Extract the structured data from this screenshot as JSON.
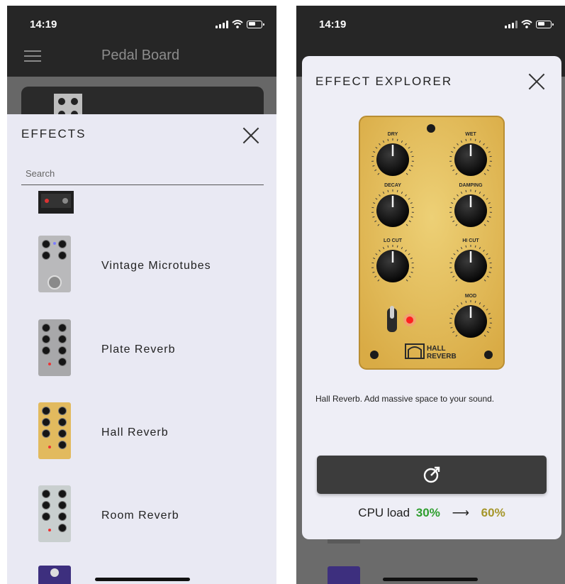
{
  "status_bar": {
    "time": "14:19"
  },
  "left": {
    "app_title": "Pedal Board",
    "sheet_title": "EFFECTS",
    "search_placeholder": "Search",
    "effects": [
      {
        "label": "Vintage Microtubes",
        "icon": "vintage-microtubes-pedal-icon",
        "color": "#b9b9bb"
      },
      {
        "label": "Plate Reverb",
        "icon": "plate-reverb-pedal-icon",
        "color": "#a8a8aa"
      },
      {
        "label": "Hall Reverb",
        "icon": "hall-reverb-pedal-icon",
        "color": "#e2ba5e"
      },
      {
        "label": "Room Reverb",
        "icon": "room-reverb-pedal-icon",
        "color": "#c9cfcf"
      }
    ]
  },
  "right": {
    "modal_title": "EFFECT EXPLORER",
    "pedal": {
      "knobs": [
        "DRY",
        "WET",
        "DECAY",
        "DAMPING",
        "LO CUT",
        "HI CUT",
        "MOD"
      ],
      "logo_line1": "HALL",
      "logo_line2": "REVERB",
      "body_color": "#e5c064"
    },
    "description": "Hall Reverb. Add massive space to your sound.",
    "action_icon": "tuning-knob-icon",
    "cpu": {
      "label": "CPU load",
      "from": "30%",
      "arrow": "⟶",
      "to": "60%"
    }
  }
}
